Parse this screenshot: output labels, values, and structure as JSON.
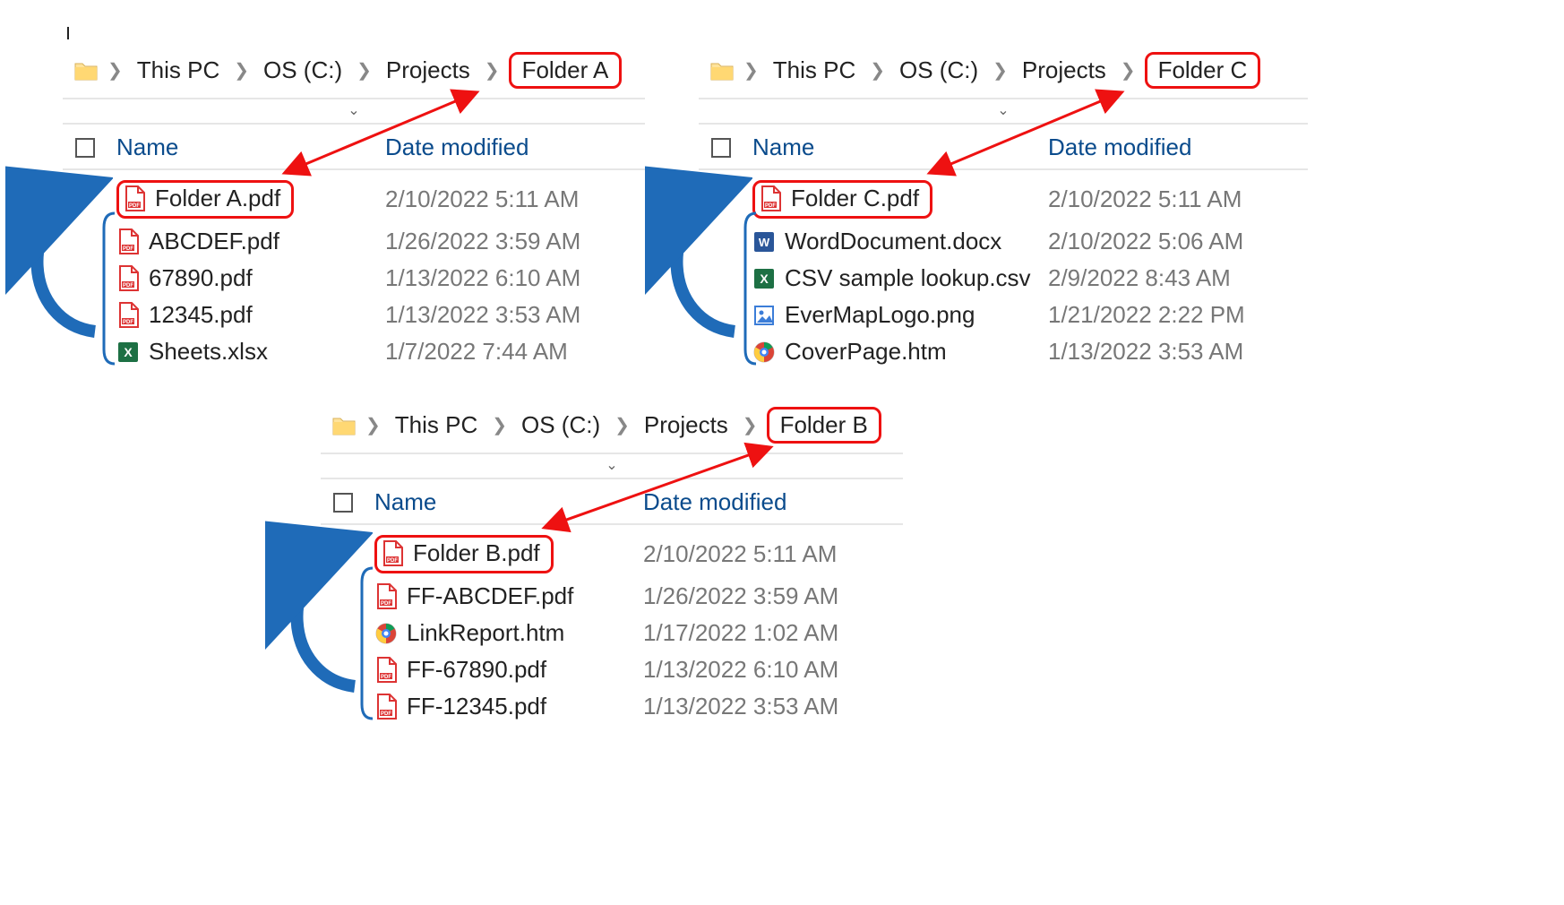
{
  "panes": [
    {
      "id": "A",
      "breadcrumb": [
        "This PC",
        "OS (C:)",
        "Projects",
        "Folder A"
      ],
      "col_name": "Name",
      "col_date": "Date modified",
      "files": [
        {
          "name": "Folder A.pdf",
          "date": "2/10/2022 5:11 AM",
          "icon": "pdf",
          "hl": true
        },
        {
          "name": "ABCDEF.pdf",
          "date": "1/26/2022 3:59 AM",
          "icon": "pdf"
        },
        {
          "name": "67890.pdf",
          "date": "1/13/2022 6:10 AM",
          "icon": "pdf"
        },
        {
          "name": "12345.pdf",
          "date": "1/13/2022 3:53 AM",
          "icon": "pdf"
        },
        {
          "name": "Sheets.xlsx",
          "date": "1/7/2022 7:44 AM",
          "icon": "xlsx"
        }
      ]
    },
    {
      "id": "C",
      "breadcrumb": [
        "This PC",
        "OS (C:)",
        "Projects",
        "Folder C"
      ],
      "col_name": "Name",
      "col_date": "Date modified",
      "files": [
        {
          "name": "Folder C.pdf",
          "date": "2/10/2022 5:11 AM",
          "icon": "pdf",
          "hl": true
        },
        {
          "name": "WordDocument.docx",
          "date": "2/10/2022 5:06 AM",
          "icon": "docx"
        },
        {
          "name": "CSV sample lookup.csv",
          "date": "2/9/2022 8:43 AM",
          "icon": "csv"
        },
        {
          "name": "EverMapLogo.png",
          "date": "1/21/2022 2:22 PM",
          "icon": "png"
        },
        {
          "name": "CoverPage.htm",
          "date": "1/13/2022 3:53 AM",
          "icon": "htm"
        }
      ]
    },
    {
      "id": "B",
      "breadcrumb": [
        "This PC",
        "OS (C:)",
        "Projects",
        "Folder B"
      ],
      "col_name": "Name",
      "col_date": "Date modified",
      "files": [
        {
          "name": "Folder B.pdf",
          "date": "2/10/2022 5:11 AM",
          "icon": "pdf",
          "hl": true
        },
        {
          "name": "FF-ABCDEF.pdf",
          "date": "1/26/2022 3:59 AM",
          "icon": "pdf"
        },
        {
          "name": "LinkReport.htm",
          "date": "1/17/2022 1:02 AM",
          "icon": "htm"
        },
        {
          "name": "FF-67890.pdf",
          "date": "1/13/2022 6:10 AM",
          "icon": "pdf"
        },
        {
          "name": "FF-12345.pdf",
          "date": "1/13/2022 3:53 AM",
          "icon": "pdf"
        }
      ]
    }
  ]
}
